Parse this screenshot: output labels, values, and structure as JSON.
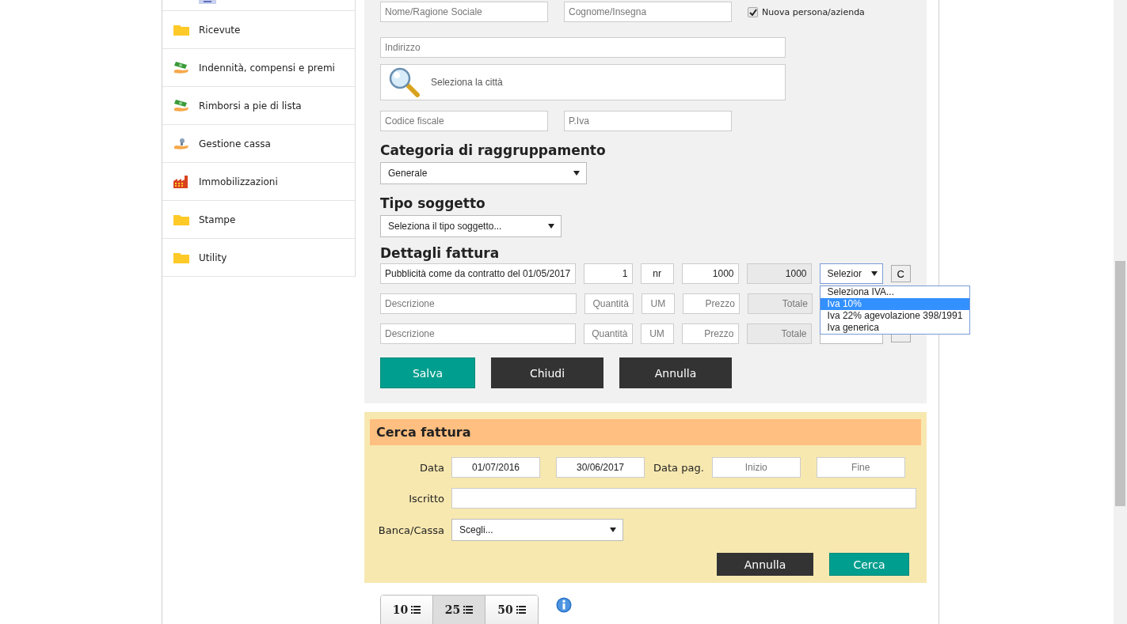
{
  "sidebar": {
    "items": [
      {
        "label": "Ricevute",
        "kind": "folder"
      },
      {
        "label": "Indennità, compensi e premi",
        "kind": "money"
      },
      {
        "label": "Rimborsi a pie di lista",
        "kind": "money"
      },
      {
        "label": "Gestione cassa",
        "kind": "coins"
      },
      {
        "label": "Immobilizzazioni",
        "kind": "factory"
      },
      {
        "label": "Stampe",
        "kind": "folder"
      },
      {
        "label": "Utility",
        "kind": "folder"
      }
    ]
  },
  "form": {
    "name_fields": [
      {
        "placeholder": "Nome/Ragione Sociale"
      },
      {
        "placeholder": "Cognome/Insegna"
      }
    ],
    "new_checkbox": {
      "label": "Nuova persona/azienda",
      "checked": true
    },
    "address": {
      "placeholder": "Indirizzo"
    },
    "city_search": {
      "placeholder": "Seleziona la città"
    },
    "tax_fields": [
      {
        "placeholder": "Codice fiscale"
      },
      {
        "placeholder": "P.Iva"
      }
    ],
    "category": {
      "heading": "Categoria di raggruppamento",
      "value": "Generale"
    },
    "subject_type": {
      "heading": "Tipo soggetto",
      "value": "Seleziona il tipo soggetto..."
    },
    "invoice_details": {
      "heading": "Dettagli fattura",
      "rows": [
        {
          "description": {
            "value": "Pubblicità come da contratto del 01/05/2017"
          },
          "quantity": {
            "value": "1"
          },
          "unit": {
            "value": "nr"
          },
          "price": {
            "value": "1000"
          },
          "total": {
            "value": "1000"
          },
          "vat": "Selezior",
          "clear": "C",
          "vat_options": [
            {
              "label": "Seleziona IVA...",
              "selected": false
            },
            {
              "label": "Iva 10%",
              "selected": true
            },
            {
              "label": "Iva 22% agevolazione 398/1991",
              "selected": false
            },
            {
              "label": "Iva generica",
              "selected": false
            }
          ]
        },
        {
          "description": {
            "placeholder": "Descrizione"
          },
          "quantity": {
            "placeholder": "Quantità"
          },
          "unit": {
            "placeholder": "UM"
          },
          "price": {
            "placeholder": "Prezzo"
          },
          "total": {
            "placeholder": "Totale"
          }
        },
        {
          "description": {
            "placeholder": "Descrizione"
          },
          "quantity": {
            "placeholder": "Quantità"
          },
          "unit": {
            "placeholder": "UM"
          },
          "price": {
            "placeholder": "Prezzo"
          },
          "total": {
            "placeholder": "Totale"
          }
        }
      ]
    },
    "buttons": [
      {
        "label": "Salva",
        "kind": "primary"
      },
      {
        "label": "Chiudi",
        "kind": "dark"
      },
      {
        "label": "Annulla",
        "kind": "dark"
      }
    ]
  },
  "search": {
    "title": "Cerca fattura",
    "date_label": "Data",
    "date_from": {
      "value": "01/07/2016"
    },
    "date_to": {
      "value": "30/06/2017"
    },
    "pay_label": "Data pag.",
    "pay_from": {
      "placeholder": "Inizio"
    },
    "pay_to": {
      "placeholder": "Fine"
    },
    "member_label": "Iscritto",
    "bank_label": "Banca/Cassa",
    "bank_value": "Scegli...",
    "buttons": [
      {
        "label": "Annulla",
        "kind": "dark"
      },
      {
        "label": "Cerca",
        "kind": "primary"
      }
    ]
  },
  "page_sizes": [
    {
      "label": "10",
      "selected": false
    },
    {
      "label": "25",
      "selected": true
    },
    {
      "label": "50",
      "selected": false
    }
  ]
}
